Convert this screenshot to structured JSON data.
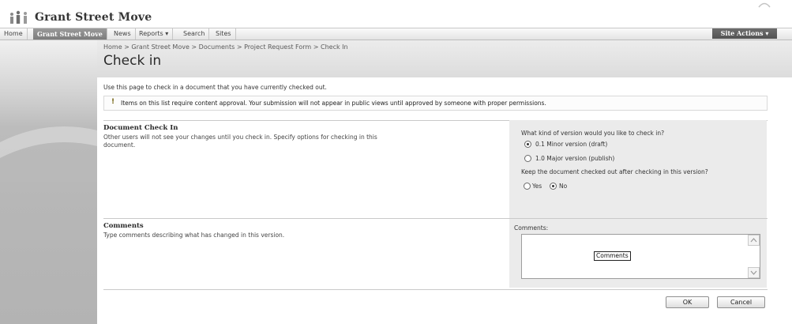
{
  "site": {
    "title": "Grant Street Move"
  },
  "nav": {
    "tabs": [
      {
        "label": "Home"
      },
      {
        "label": "Grant Street Move"
      },
      {
        "label": "News"
      },
      {
        "label": "Reports ▾"
      },
      {
        "label": "Search"
      },
      {
        "label": "Sites"
      }
    ],
    "site_actions": "Site Actions ▾"
  },
  "breadcrumb": {
    "items": [
      "Home",
      "Grant Street Move",
      "Documents",
      "Project Request Form",
      "Check In"
    ],
    "separator": " > "
  },
  "page": {
    "title": "Check in",
    "intro": "Use this page to check in a document that you have currently checked out.",
    "approval_notice": "Items on this list require content approval. Your submission will not appear in public views until approved by someone with proper permissions."
  },
  "checkin_section": {
    "title": "Document Check In",
    "description_line1": "Other users will not see your changes until you check in. Specify options for checking in this",
    "description_line2": "document.",
    "version_question": "What kind of version would you like to check in?",
    "version_options": [
      {
        "label": "0.1 Minor version (draft)",
        "checked": true
      },
      {
        "label": "1.0 Major version (publish)",
        "checked": false
      }
    ],
    "keep_question": "Keep the document checked out after checking in this version?",
    "keep_options": [
      {
        "label": "Yes",
        "checked": false
      },
      {
        "label": "No",
        "checked": true
      }
    ]
  },
  "comments_section": {
    "title": "Comments",
    "description": "Type comments describing what has changed in this version.",
    "field_label": "Comments:",
    "value": "",
    "tooltip": "Comments"
  },
  "actions": {
    "ok": "OK",
    "cancel": "Cancel"
  },
  "colors": {
    "selected_tab": "#8a8a8a",
    "site_actions": "#5f5f5f",
    "panel_bg": "#ebebeb",
    "title_band": "#e3e3e3"
  },
  "icons": {
    "logo": "people-logo-icon",
    "warning": "exclamation-icon",
    "scroll_up": "scroll-up-arrow-icon",
    "scroll_down": "scroll-down-arrow-icon"
  }
}
